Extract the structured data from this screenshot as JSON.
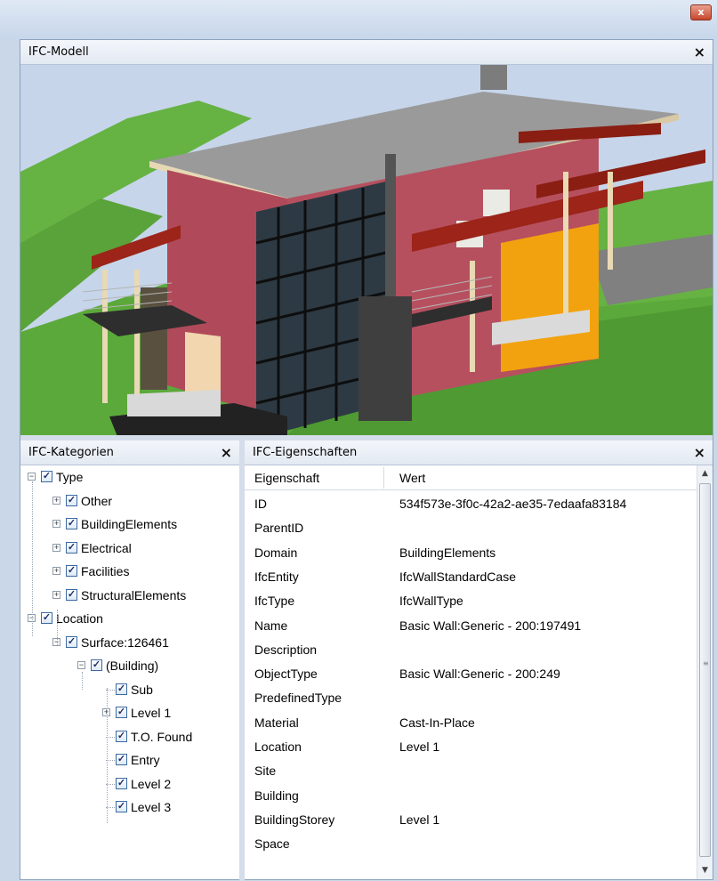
{
  "window": {
    "close_glyph": "x"
  },
  "model_panel": {
    "title": "IFC-Modell",
    "close_glyph": "×"
  },
  "categories_panel": {
    "title": "IFC-Kategorien",
    "close_glyph": "×",
    "tree": [
      {
        "label": "Type",
        "level": 0,
        "expander": "minus",
        "checked": true
      },
      {
        "label": "Other",
        "level": 1,
        "expander": "plus",
        "checked": true
      },
      {
        "label": "BuildingElements",
        "level": 1,
        "expander": "plus",
        "checked": true
      },
      {
        "label": "Electrical",
        "level": 1,
        "expander": "plus",
        "checked": true
      },
      {
        "label": "Facilities",
        "level": 1,
        "expander": "plus",
        "checked": true
      },
      {
        "label": "StructuralElements",
        "level": 1,
        "expander": "plus",
        "checked": true
      },
      {
        "label": "Location",
        "level": 0,
        "expander": "minus",
        "checked": true
      },
      {
        "label": "Surface:126461",
        "level": 1,
        "expander": "minus",
        "checked": true
      },
      {
        "label": "(Building)",
        "level": 2,
        "expander": "minus",
        "checked": true
      },
      {
        "label": "Sub",
        "level": 3,
        "expander": "none",
        "checked": true
      },
      {
        "label": "Level 1",
        "level": 3,
        "expander": "plus",
        "checked": true
      },
      {
        "label": "T.O. Found",
        "level": 3,
        "expander": "none",
        "checked": true
      },
      {
        "label": "Entry",
        "level": 3,
        "expander": "none",
        "checked": true
      },
      {
        "label": "Level 2",
        "level": 3,
        "expander": "none",
        "checked": true
      },
      {
        "label": "Level 3",
        "level": 3,
        "expander": "none",
        "checked": true
      }
    ]
  },
  "properties_panel": {
    "title": "IFC-Eigenschaften",
    "close_glyph": "×",
    "columns": [
      "Eigenschaft",
      "Wert"
    ],
    "rows": [
      [
        "ID",
        "534f573e-3f0c-42a2-ae35-7edaafa83184"
      ],
      [
        "ParentID",
        ""
      ],
      [
        "Domain",
        "BuildingElements"
      ],
      [
        "IfcEntity",
        "IfcWallStandardCase"
      ],
      [
        "IfcType",
        "IfcWallType"
      ],
      [
        "Name",
        "Basic Wall:Generic - 200:197491"
      ],
      [
        "Description",
        ""
      ],
      [
        "ObjectType",
        "Basic Wall:Generic - 200:249"
      ],
      [
        "PredefinedType",
        ""
      ],
      [
        "Material",
        "Cast-In-Place"
      ],
      [
        "Location",
        "Level 1"
      ],
      [
        "Site",
        ""
      ],
      [
        "Building",
        ""
      ],
      [
        "BuildingStorey",
        "Level 1"
      ],
      [
        "Space",
        ""
      ]
    ],
    "scroll": {
      "up_glyph": "▲",
      "down_glyph": "▼",
      "grip_glyph": "≡"
    }
  },
  "colors": {
    "terrain": "#5faa3a",
    "wall": "#b04a5a",
    "roof": "#9a9a9a",
    "beam": "#9c2418",
    "panel_orange": "#f2a20e",
    "glass_frame": "#1b1b1b"
  }
}
